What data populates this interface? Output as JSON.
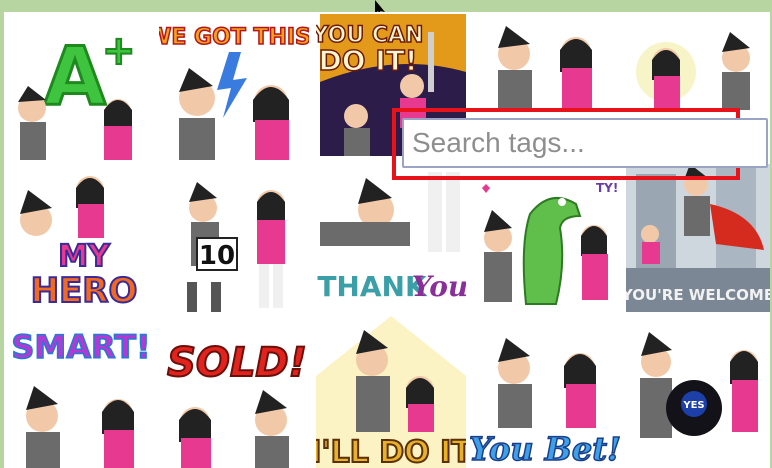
{
  "search": {
    "placeholder": "Search tags..."
  },
  "stickers": [
    {
      "caption": "A+"
    },
    {
      "caption": "WE GOT THIS!"
    },
    {
      "caption": "YOU CAN DO IT!"
    },
    {
      "caption": ""
    },
    {
      "caption": ""
    },
    {
      "caption": "MY HERO"
    },
    {
      "caption": "10"
    },
    {
      "caption": "THANK YOU"
    },
    {
      "caption": ""
    },
    {
      "caption": "YOU'RE WELCOME"
    },
    {
      "caption": "SMART!"
    },
    {
      "caption": "SOLD!"
    },
    {
      "caption": "I'LL DO IT"
    },
    {
      "caption": "YOU BET!"
    },
    {
      "caption": "YES"
    }
  ],
  "colors": {
    "background": "#b7d5a0",
    "highlight": "#e8131a",
    "pink": "#e6398f",
    "shirt": "#6b6b6b"
  }
}
